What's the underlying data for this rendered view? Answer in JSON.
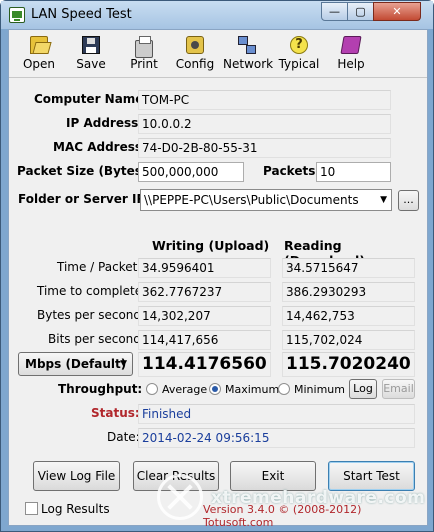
{
  "window": {
    "title": "LAN Speed Test",
    "minimize": "—",
    "maximize": "▢",
    "close": "✕"
  },
  "toolbar": [
    {
      "label": "Open",
      "icon": "folder-open-icon"
    },
    {
      "label": "Save",
      "icon": "floppy-disk-icon"
    },
    {
      "label": "Print",
      "icon": "printer-icon"
    },
    {
      "label": "Config",
      "icon": "config-gear-icon"
    },
    {
      "label": "Network",
      "icon": "network-computers-icon"
    },
    {
      "label": "Typical",
      "icon": "lightbulb-question-icon"
    },
    {
      "label": "Help",
      "icon": "help-book-icon"
    }
  ],
  "info": {
    "computer_name_label": "Computer Name:",
    "computer_name": "TOM-PC",
    "ip_label": "IP Address:",
    "ip": "10.0.0.2",
    "mac_label": "MAC Address:",
    "mac": "74-D0-2B-80-55-31",
    "packet_size_label": "Packet Size (Bytes):",
    "packet_size": "500,000,000",
    "packets_label": "Packets:",
    "packets": "10",
    "folder_label": "Folder or Server IP:",
    "folder": "\\\\PEPPE-PC\\Users\\Public\\Documents",
    "browse": "..."
  },
  "results": {
    "writing_header": "Writing (Upload)",
    "reading_header": "Reading (Download)",
    "rows": [
      {
        "label": "Time / Packet:",
        "write": "34.9596401",
        "read": "34.5715647"
      },
      {
        "label": "Time to complete:",
        "write": "362.7767237",
        "read": "386.2930293"
      },
      {
        "label": "Bytes per second:",
        "write": "14,302,207",
        "read": "14,462,753"
      },
      {
        "label": "Bits per second:",
        "write": "114,417,656",
        "read": "115,702,024"
      }
    ],
    "units": "Mbps (Default)",
    "mbps_write": "114.4176560",
    "mbps_read": "115.7020240"
  },
  "throughput": {
    "label": "Throughput:",
    "options": [
      "Average",
      "Maximum",
      "Minimum"
    ],
    "selected": "Maximum",
    "log_btn": "Log",
    "email_btn": "Email"
  },
  "status": {
    "label": "Status:",
    "value": "Finished",
    "label_color": "#b1272c"
  },
  "date": {
    "label": "Date:",
    "value": "2014-02-24  09:56:15"
  },
  "buttons": {
    "view_log": "View Log File",
    "clear": "Clear Results",
    "exit": "Exit",
    "start": "Start Test"
  },
  "footer": {
    "log_results": "Log Results",
    "version": "Version 3.4.0  ©  (2008-2012) Totusoft.com",
    "watermark": "xtremehardware.com"
  }
}
